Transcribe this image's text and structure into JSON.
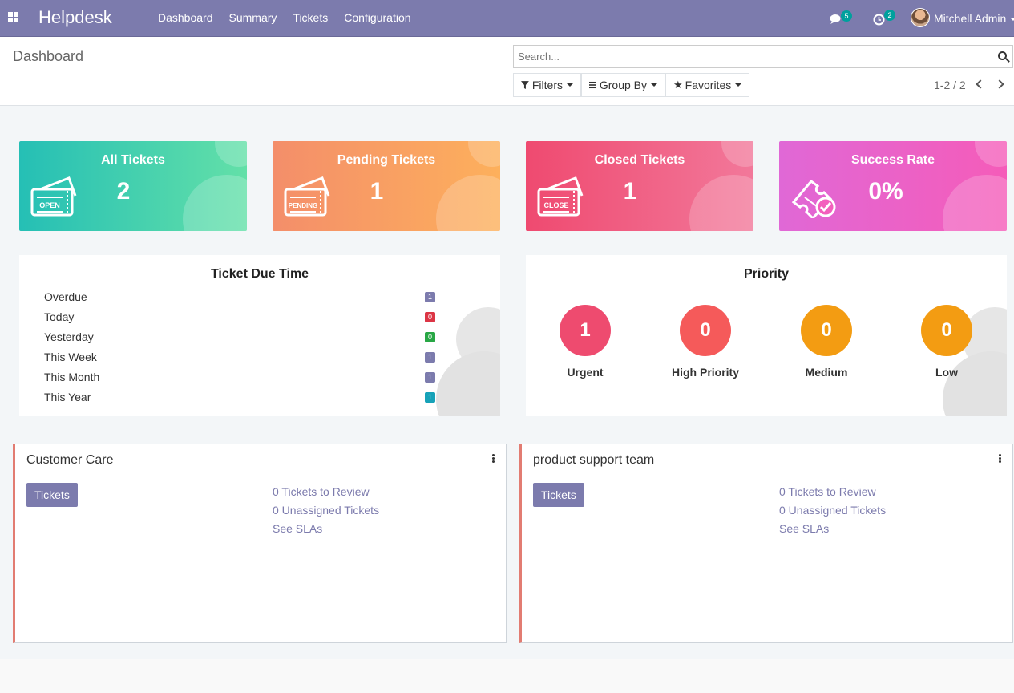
{
  "navbar": {
    "brand": "Helpdesk",
    "menu": [
      "Dashboard",
      "Summary",
      "Tickets",
      "Configuration"
    ],
    "messages_count": "5",
    "activities_count": "2",
    "user_name": "Mitchell Admin",
    "color": "#7c7bad"
  },
  "control": {
    "breadcrumb": "Dashboard",
    "search_placeholder": "Search...",
    "filters": "Filters",
    "group_by": "Group By",
    "favorites": "Favorites",
    "pager": "1-2 / 2"
  },
  "cards": [
    {
      "title": "All Tickets",
      "value": "2",
      "icon_text": "OPEN",
      "icon": "ticket-icon",
      "colors": [
        "#25bfb5",
        "#63e0a8"
      ]
    },
    {
      "title": "Pending Tickets",
      "value": "1",
      "icon_text": "PENDING",
      "icon": "ticket-icon",
      "colors": [
        "#f48e6a",
        "#fdb05c"
      ]
    },
    {
      "title": "Closed Tickets",
      "value": "1",
      "icon_text": "CLOSE",
      "icon": "ticket-icon",
      "colors": [
        "#ef4a70",
        "#f2789a"
      ]
    },
    {
      "title": "Success Rate",
      "value": "0%",
      "icon_text": "",
      "icon": "ticket-check-icon",
      "colors": [
        "#e068d6",
        "#f55cb9"
      ]
    }
  ],
  "due_time": {
    "title": "Ticket Due Time",
    "rows": [
      {
        "label": "Overdue",
        "count": "1",
        "color": "#7c7bad"
      },
      {
        "label": "Today",
        "count": "0",
        "color": "#dc3545"
      },
      {
        "label": "Yesterday",
        "count": "0",
        "color": "#28a745"
      },
      {
        "label": "This Week",
        "count": "1",
        "color": "#7c7bad"
      },
      {
        "label": "This Month",
        "count": "1",
        "color": "#7c7bad"
      },
      {
        "label": "This Year",
        "count": "1",
        "color": "#17a2b8"
      }
    ]
  },
  "priority": {
    "title": "Priority",
    "items": [
      {
        "label": "Urgent",
        "value": "1",
        "color": "#ee4b6f"
      },
      {
        "label": "High Priority",
        "value": "0",
        "color": "#f55a5a"
      },
      {
        "label": "Medium",
        "value": "0",
        "color": "#f39c12"
      },
      {
        "label": "Low",
        "value": "0",
        "color": "#f39c12"
      }
    ]
  },
  "teams": [
    {
      "name": "Customer Care",
      "button": "Tickets",
      "links": [
        "0 Tickets to Review",
        "0 Unassigned Tickets",
        "See SLAs"
      ]
    },
    {
      "name": "product support team",
      "button": "Tickets",
      "links": [
        "0 Tickets to Review",
        "0 Unassigned Tickets",
        "See SLAs"
      ]
    }
  ]
}
